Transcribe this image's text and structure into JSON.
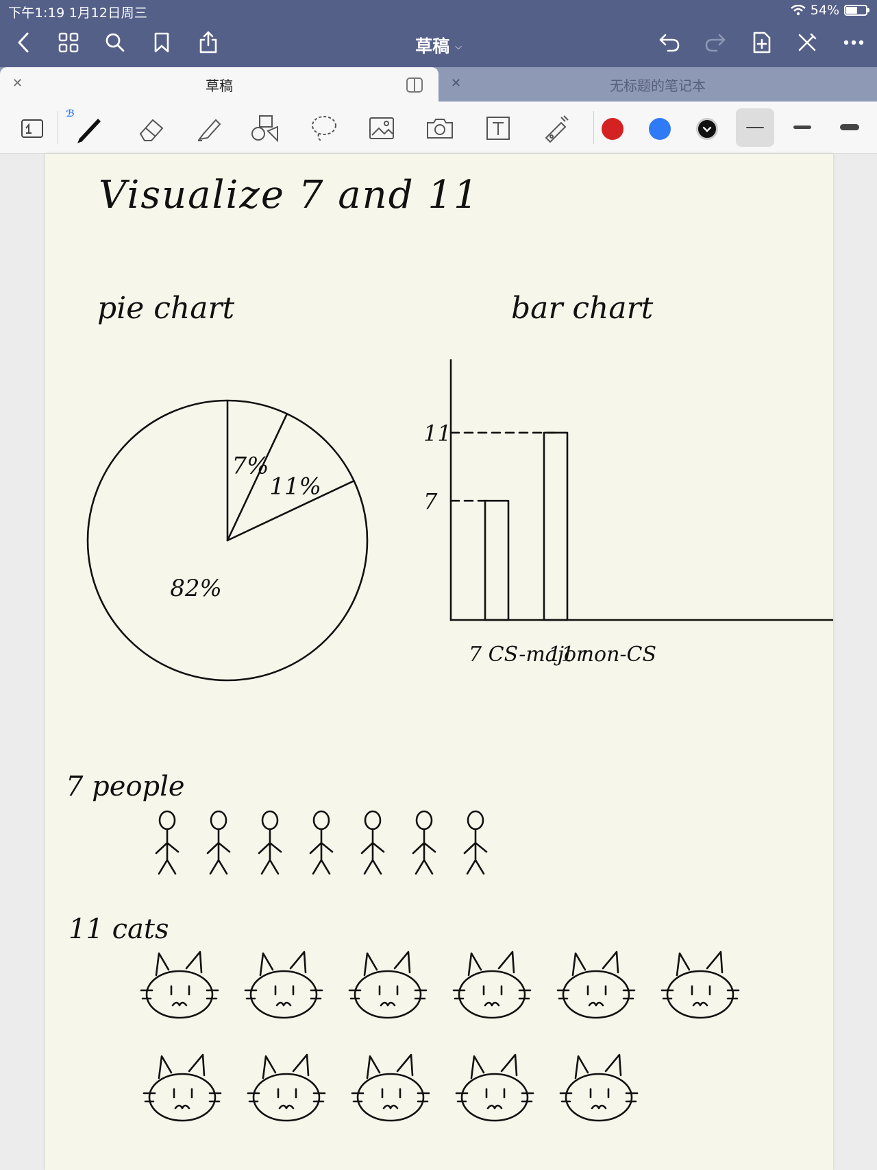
{
  "status_bar": {
    "time": "下午1:19   1月12日周三",
    "battery_text": "54%",
    "battery_level": 0.54
  },
  "nav": {
    "title": "草稿"
  },
  "tabs": [
    {
      "label": "草稿",
      "active": true
    },
    {
      "label": "无标题的笔记本",
      "active": false
    }
  ],
  "toolbar": {
    "colors": [
      "#d42222",
      "#2f7bf5",
      "#111111"
    ],
    "tools": [
      "pen-icon",
      "eraser-icon",
      "highlighter-icon",
      "shapes-icon",
      "lasso-icon",
      "image-icon",
      "camera-icon",
      "text-box-icon",
      "laser-pointer-icon"
    ]
  },
  "note": {
    "title": "Visualize  7  and  11",
    "pie_heading": "pie  chart",
    "bar_heading": "bar  chart",
    "people_label": "7 people",
    "cats_label": "11 cats",
    "people_count": 7,
    "cats_count": 11
  },
  "chart_data": [
    {
      "type": "pie",
      "slices": [
        {
          "label": "7%",
          "value": 7
        },
        {
          "label": "11%",
          "value": 11
        },
        {
          "label": "82%",
          "value": 82
        }
      ]
    },
    {
      "type": "bar",
      "categories": [
        "CS-major",
        "non-CS"
      ],
      "category_labels": [
        "7 CS-major",
        "11 non-CS"
      ],
      "values": [
        7,
        11
      ],
      "ytick_labels": [
        "11",
        "7"
      ]
    }
  ]
}
